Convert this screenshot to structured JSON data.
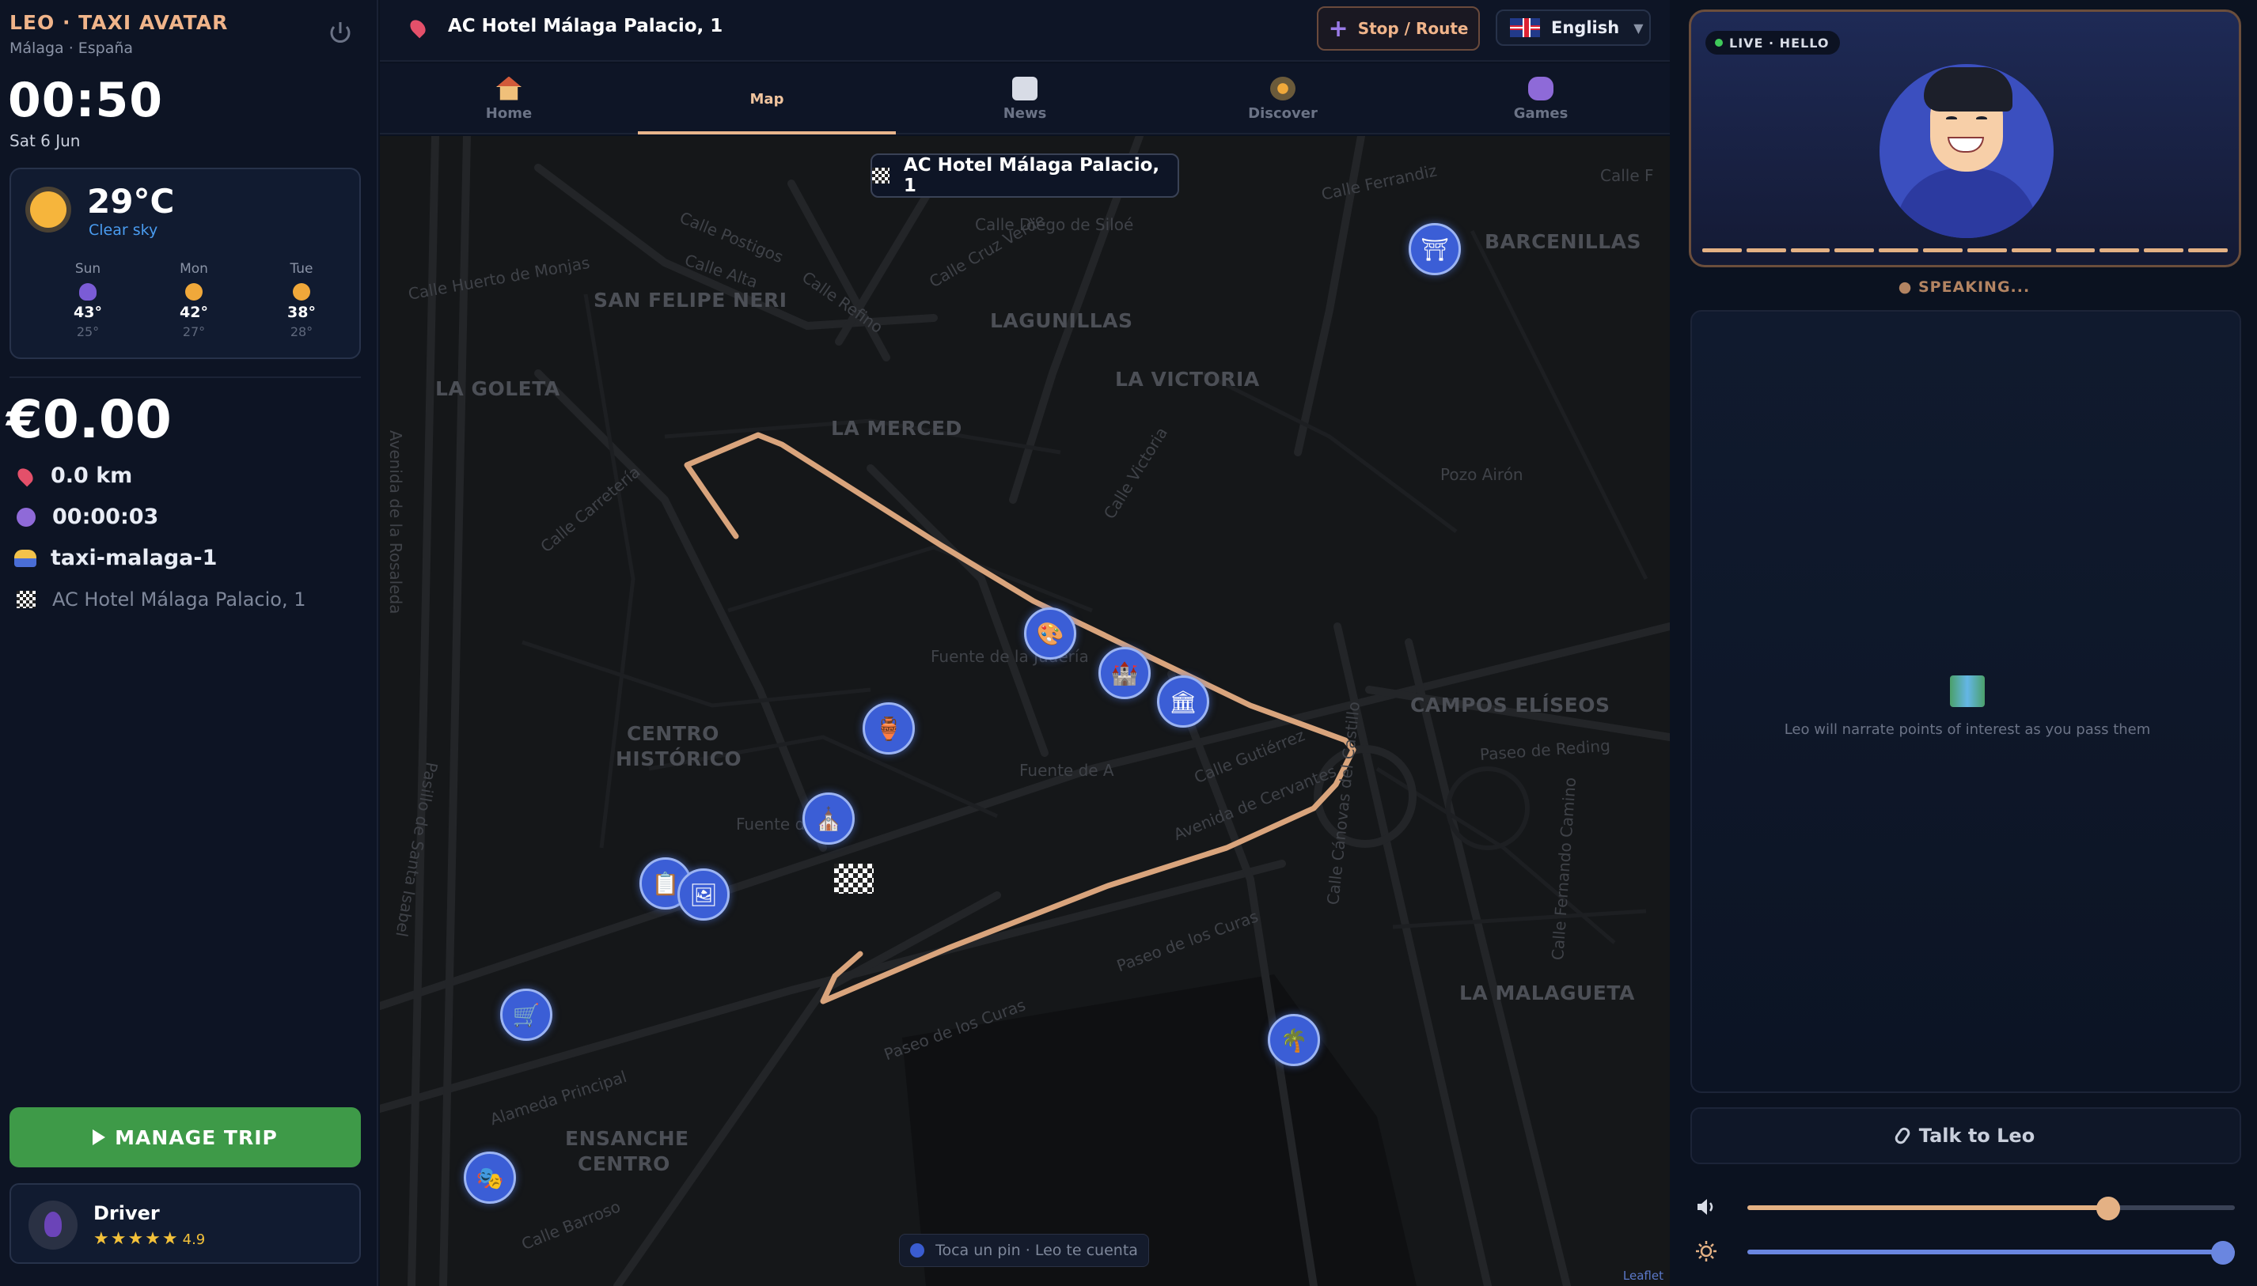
{
  "app": {
    "brand": "LEO · TAXI AVATAR",
    "location": "Málaga · España"
  },
  "clock": {
    "time": "00:50",
    "date": "Sat 6 Jun"
  },
  "weather": {
    "temp": "29°C",
    "condition": "Clear sky",
    "forecast": [
      {
        "day": "Sun",
        "hi": "43°",
        "lo": "25°",
        "icon": "storm-icon"
      },
      {
        "day": "Mon",
        "hi": "42°",
        "lo": "27°",
        "icon": "sun-icon"
      },
      {
        "day": "Tue",
        "hi": "38°",
        "lo": "28°",
        "icon": "sun-icon"
      }
    ]
  },
  "trip": {
    "fare": "€0.00",
    "distance": "0.0 km",
    "duration": "00:00:03",
    "vehicle": "taxi-malaga-1",
    "destination": "AC Hotel Málaga Palacio, 1"
  },
  "actions": {
    "manage": "MANAGE TRIP"
  },
  "driver": {
    "name": "Driver",
    "stars": "★★★★★",
    "rating": "4.9"
  },
  "topbar": {
    "destination": "AC Hotel Málaga Palacio, 1",
    "stop_route": "Stop / Route",
    "language": "English"
  },
  "nav": {
    "tabs": [
      {
        "label": "Home",
        "icon": "home-icon"
      },
      {
        "label": "Map",
        "icon": "map-icon",
        "active": true
      },
      {
        "label": "News",
        "icon": "news-icon"
      },
      {
        "label": "Discover",
        "icon": "compass-icon"
      },
      {
        "label": "Games",
        "icon": "gamepad-icon"
      }
    ]
  },
  "map": {
    "destination_chip": "AC Hotel Málaga Palacio, 1",
    "hint": "Toca un pin · Leo te cuenta",
    "attribution": "Leaflet",
    "areas": [
      "SAN FELIPE NERI",
      "LAGUNILLAS",
      "LA VICTORIA",
      "LA GOLETA",
      "LA MERCED",
      "BARCENILLAS",
      "CAMPOS ELÍSEOS",
      "LA MALAGUETA",
      "CENTRO",
      "HISTÓRICO",
      "ENSANCHE",
      "CENTRO"
    ],
    "streets": [
      "Calle Ferrandiz",
      "Calle F",
      "Calle Postigos",
      "Calle Refino",
      "Calle Cruz Verde",
      "Calle Alta",
      "Calle Diego de Siloé",
      "Calle Huerto de Monjas",
      "Calle Carretería",
      "Calle Victoria",
      "Paseo de Reding",
      "Calle Gutiérrez",
      "Avenida de Cervantes",
      "Paseo de los Curas",
      "Paseo de los Curas",
      "Alameda Principal",
      "Calle Barroso",
      "Pozo Airón",
      "Fuente de la Judería",
      "Fuente de A",
      "Fuente del Ob",
      "Avenida de la Rosaleda",
      "Pasillo de Santa Isabel",
      "Calle Cánovas del Castillo",
      "Calle Fernando Camino"
    ]
  },
  "avatar": {
    "live_label": "LIVE · HELLO",
    "status": "● SPEAKING...",
    "narration_hint": "Leo will narrate points of interest as you pass them",
    "talk": "Talk to Leo",
    "volume": 0.74,
    "brightness": 1.0
  },
  "colors": {
    "accent": "#e8b58c",
    "route": "#d9a47c",
    "poi": "#3b5ed6",
    "primary_green": "#3e9a48",
    "background": "#0b1220"
  }
}
